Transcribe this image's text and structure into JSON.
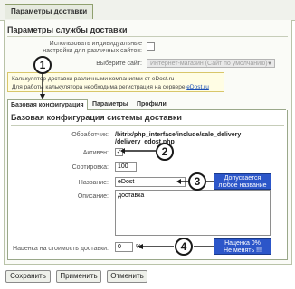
{
  "window": {
    "tab_label": "Параметры доставки"
  },
  "section": {
    "title": "Параметры службы доставки",
    "individual_settings_label": "Использовать индивидуальные настройки для различных сайтов:",
    "site_label": "Выберите сайт:",
    "site_value": "Интернет-магазин (Сайт по умолчанию)"
  },
  "note": {
    "line1": "Калькулятор доставки различными компаниями от eDost.ru",
    "line2_prefix": "Для работы калькулятора необходима регистрация на сервере",
    "line2_link": "eDost.ru"
  },
  "subtabs": [
    {
      "label": "Базовая конфигурация"
    },
    {
      "label": "Параметры"
    },
    {
      "label": "Профили"
    }
  ],
  "form": {
    "title": "Базовая конфигурация системы доставки",
    "handler_label": "Обработчик:",
    "handler_value_1": "/bitrix/php_interface/include/sale_delivery",
    "handler_value_2": "/delivery_edost.php",
    "active_label": "Активен:",
    "active_checked": true,
    "sort_label": "Сортировка:",
    "sort_value": "100",
    "name_label": "Название:",
    "name_value": "eDost",
    "desc_label": "Описание:",
    "desc_value": "доставка",
    "markup_label": "Наценка на стоимость доставки:",
    "markup_value": "0",
    "markup_unit": "%"
  },
  "annotations": {
    "marker_1": "1",
    "marker_2": "2",
    "marker_3": "3",
    "marker_4": "4",
    "callout_3_line1": "Допускается",
    "callout_3_line2": "любое название",
    "callout_4_line1": "Наценка 0%",
    "callout_4_line2": "Не менять !!!",
    "annotation_color": "#2c56c9"
  },
  "buttons": {
    "save": "Сохранить",
    "apply": "Применить",
    "cancel": "Отменить"
  },
  "icons": {
    "checkbox": "checkbox-icon",
    "dropdown": "chevron-down-icon"
  }
}
